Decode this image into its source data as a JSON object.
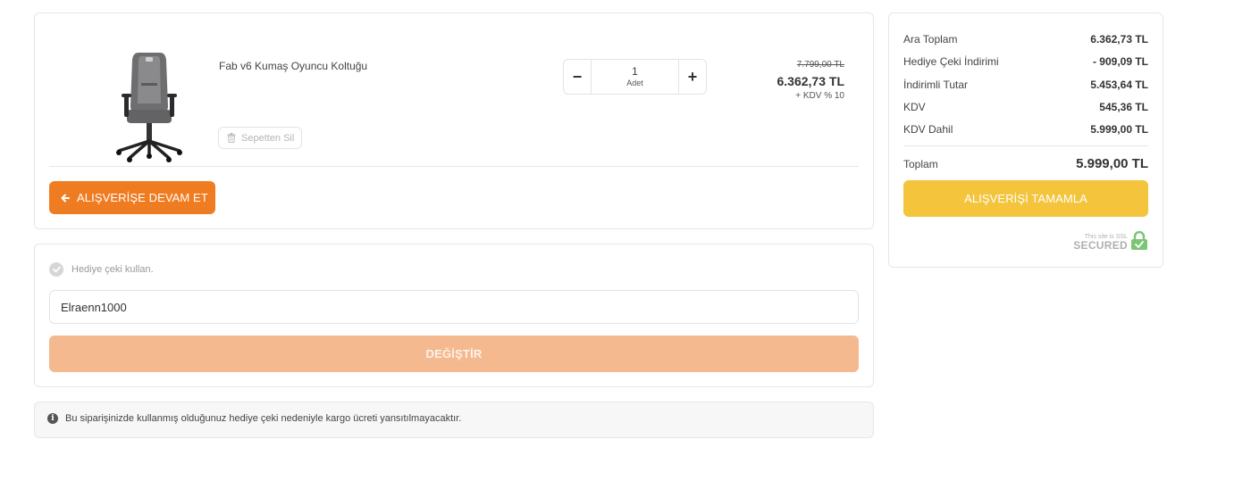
{
  "cart": {
    "product": {
      "name": "Fab v6 Kumaş Oyuncu Koltuğu",
      "image_icon": "gaming-chair-image",
      "remove_label": "Sepetten Sil",
      "quantity": "1",
      "quantity_unit": "Adet",
      "price_old": "7.799,00 TL",
      "price_new": "6.362,73 TL",
      "tax_note": "+ KDV % 10"
    },
    "continue_label": "ALIŞVERİŞE DEVAM ET"
  },
  "gift": {
    "toggle_label": "Hediye çeki kullan.",
    "input_value": "Elraenn1000",
    "change_label": "DEĞİŞTİR"
  },
  "notice": {
    "text": "Bu siparişinizde kullanmış olduğunuz hediye çeki nedeniyle kargo ücreti yansıtılmayacaktır."
  },
  "summary": {
    "rows": [
      {
        "label": "Ara Toplam",
        "value": "6.362,73 TL"
      },
      {
        "label": "Hediye Çeki İndirimi",
        "value": "- 909,09 TL"
      },
      {
        "label": "İndirimli Tutar",
        "value": "5.453,64 TL"
      },
      {
        "label": "KDV",
        "value": "545,36 TL"
      },
      {
        "label": "KDV Dahil",
        "value": "5.999,00 TL"
      }
    ],
    "total_label": "Toplam",
    "total_value": "5.999,00 TL",
    "checkout_label": "ALIŞVERİŞİ TAMAMLA",
    "ssl_small": "This site is SSL",
    "ssl_big": "SECURED"
  },
  "colors": {
    "accent_orange": "#f07c22",
    "disabled_orange": "#f5b990",
    "checkout_yellow": "#f3c43c",
    "ssl_green": "#7cc576"
  }
}
